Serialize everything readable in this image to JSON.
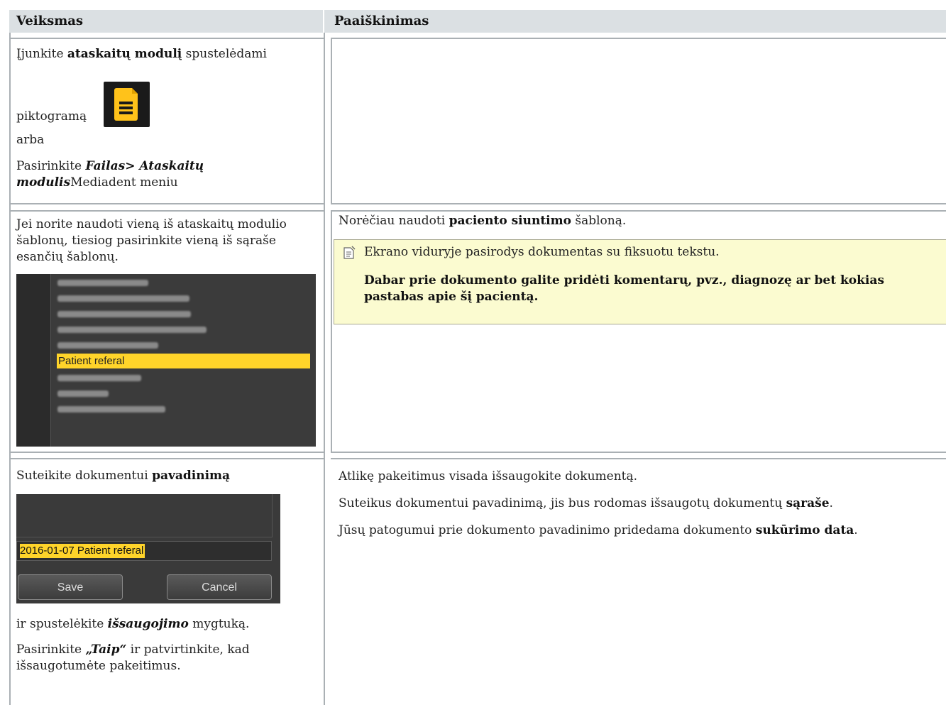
{
  "header": {
    "col1": "Veiksmas",
    "col2": "Paaiškinimas"
  },
  "row1": {
    "l1_pre": "Įjunkite ",
    "l1_bold": "ataskaitų modulį",
    "l1_post": " spustelėdami",
    "l2": "piktogramą",
    "l3": "arba",
    "l4_pre": "Pasirinkite ",
    "l4_bi": "Failas> Ataskaitų modulis",
    "l4_post": "Mediadent meniu",
    "icon": "report-document-icon"
  },
  "row2": {
    "left": "Jei norite naudoti vieną iš ataskaitų modulio šablonų, tiesiog pasirinkite vieną iš sąraše esančių šablonų.",
    "right_pre": "Norėčiau naudoti ",
    "right_bold": "paciento siuntimo",
    "right_post": " šabloną.",
    "note_line1": "Ekrano viduryje pasirodys dokumentas su fiksuotu tekstu.",
    "note_line2": "Dabar prie dokumento galite pridėti komentarų, pvz., diagnozę ar bet kokias pastabas apie šį pacientą.",
    "note_icon": "note-icon",
    "screenshot_selected": "Patient referal"
  },
  "row3": {
    "l1_pre": "Suteikite dokumentui ",
    "l1_bold": "pavadinimą",
    "field_value": "2016-01-07 Patient referal",
    "save_label": "Save",
    "cancel_label": "Cancel",
    "l2_pre": "ir spustelėkite ",
    "l2_bi": "išsaugojimo",
    "l2_post": " mygtuką.",
    "l3_pre": "Pasirinkite ",
    "l3_bi": "„Taip“",
    "l3_post": " ir patvirtinkite, kad išsaugotumėte pakeitimus.",
    "r1": "Atlikę pakeitimus visada išsaugokite dokumentą.",
    "r2_pre": "Suteikus dokumentui pavadinimą, jis bus rodomas išsaugotų dokumentų ",
    "r2_bold": "sąraše",
    "r2_post": ".",
    "r3_pre": "Jūsų patogumui prie dokumento pavadinimo pridedama dokumento ",
    "r3_bold": "sukūrimo data",
    "r3_post": "."
  }
}
